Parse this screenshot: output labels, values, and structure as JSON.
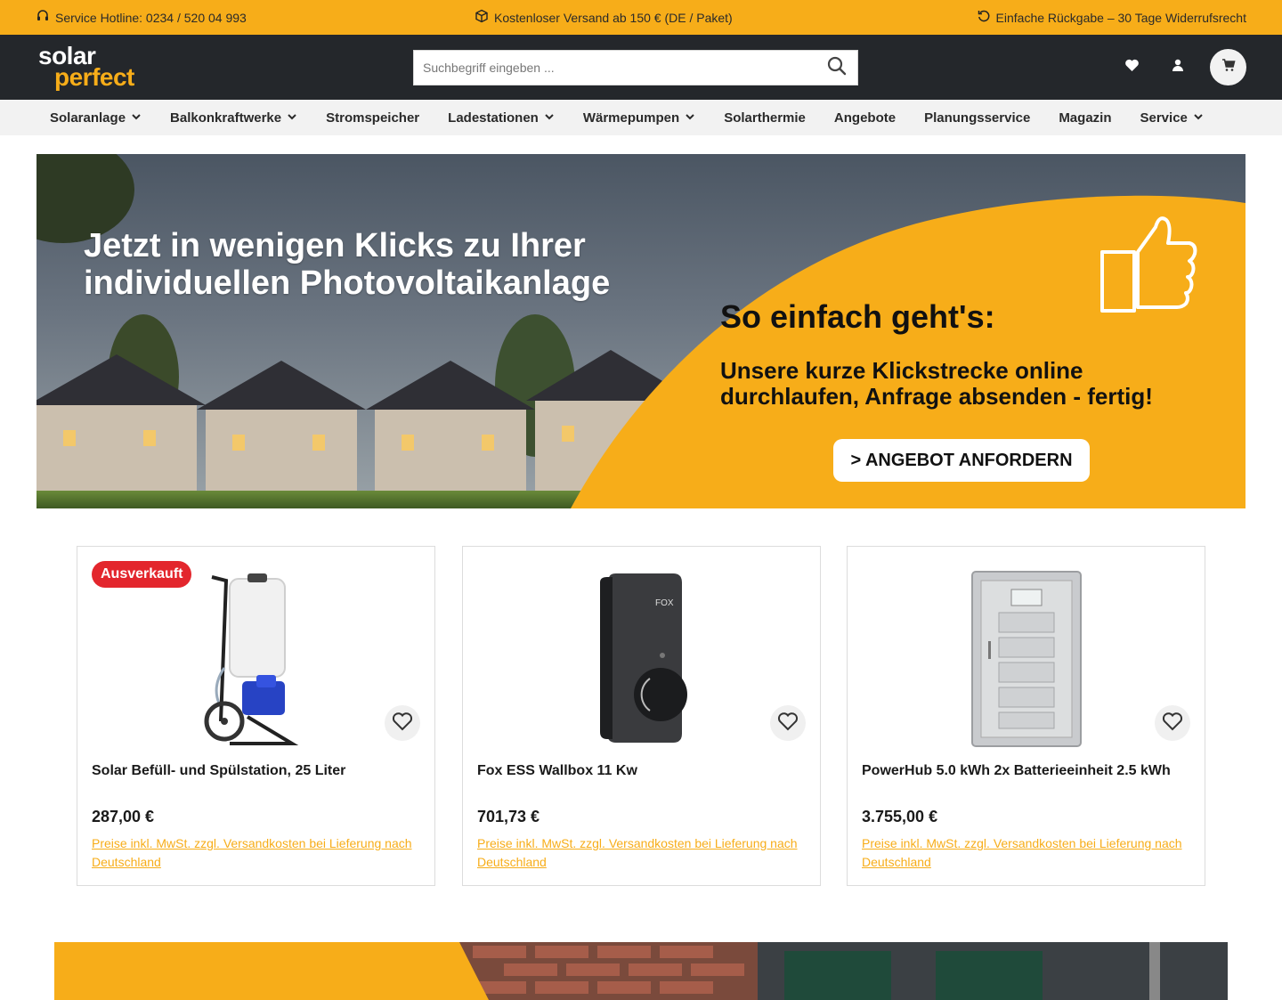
{
  "topbar": {
    "hotline": "Service Hotline: 0234 / 520 04 993",
    "shipping": "Kostenloser Versand ab 150 € (DE / Paket)",
    "returns": "Einfache Rückgabe – 30 Tage Widerrufsrecht"
  },
  "header": {
    "logo_top": "solar",
    "logo_bottom": "perfect",
    "search_placeholder": "Suchbegriff eingeben ..."
  },
  "nav": {
    "items": [
      {
        "label": "Solaranlage",
        "dropdown": true
      },
      {
        "label": "Balkonkraftwerke",
        "dropdown": true
      },
      {
        "label": "Stromspeicher",
        "dropdown": false
      },
      {
        "label": "Ladestationen",
        "dropdown": true
      },
      {
        "label": "Wärmepumpen",
        "dropdown": true
      },
      {
        "label": "Solarthermie",
        "dropdown": false
      },
      {
        "label": "Angebote",
        "dropdown": false
      },
      {
        "label": "Planungsservice",
        "dropdown": false
      },
      {
        "label": "Magazin",
        "dropdown": false
      },
      {
        "label": "Service",
        "dropdown": true
      }
    ]
  },
  "hero": {
    "title": "Jetzt in wenigen Klicks zu Ihrer individuellen Photovoltaikanlage",
    "subtitle": "So einfach geht's:",
    "text": "Unsere kurze Klickstrecke online durchlaufen, Anfrage absenden - fertig!",
    "button": "> ANGEBOT ANFORDERN"
  },
  "products": [
    {
      "name": "Solar Befüll- und Spülstation, 25 Liter",
      "price": "287,00 €",
      "badge": "Ausverkauft",
      "vat": "Preise inkl. MwSt. zzgl. Versandkosten bei Lieferung nach Deutschland"
    },
    {
      "name": "Fox ESS Wallbox 11 Kw",
      "price": "701,73 €",
      "badge": "",
      "vat": "Preise inkl. MwSt. zzgl. Versandkosten bei Lieferung nach Deutschland"
    },
    {
      "name": "PowerHub 5.0 kWh 2x Batterieeinheit 2.5 kWh",
      "price": "3.755,00 €",
      "badge": "",
      "vat": "Preise inkl. MwSt. zzgl. Versandkosten bei Lieferung nach Deutschland"
    }
  ],
  "colors": {
    "accent": "#f7ad19",
    "header_bg": "#24272b",
    "badge_red": "#e3262d"
  }
}
